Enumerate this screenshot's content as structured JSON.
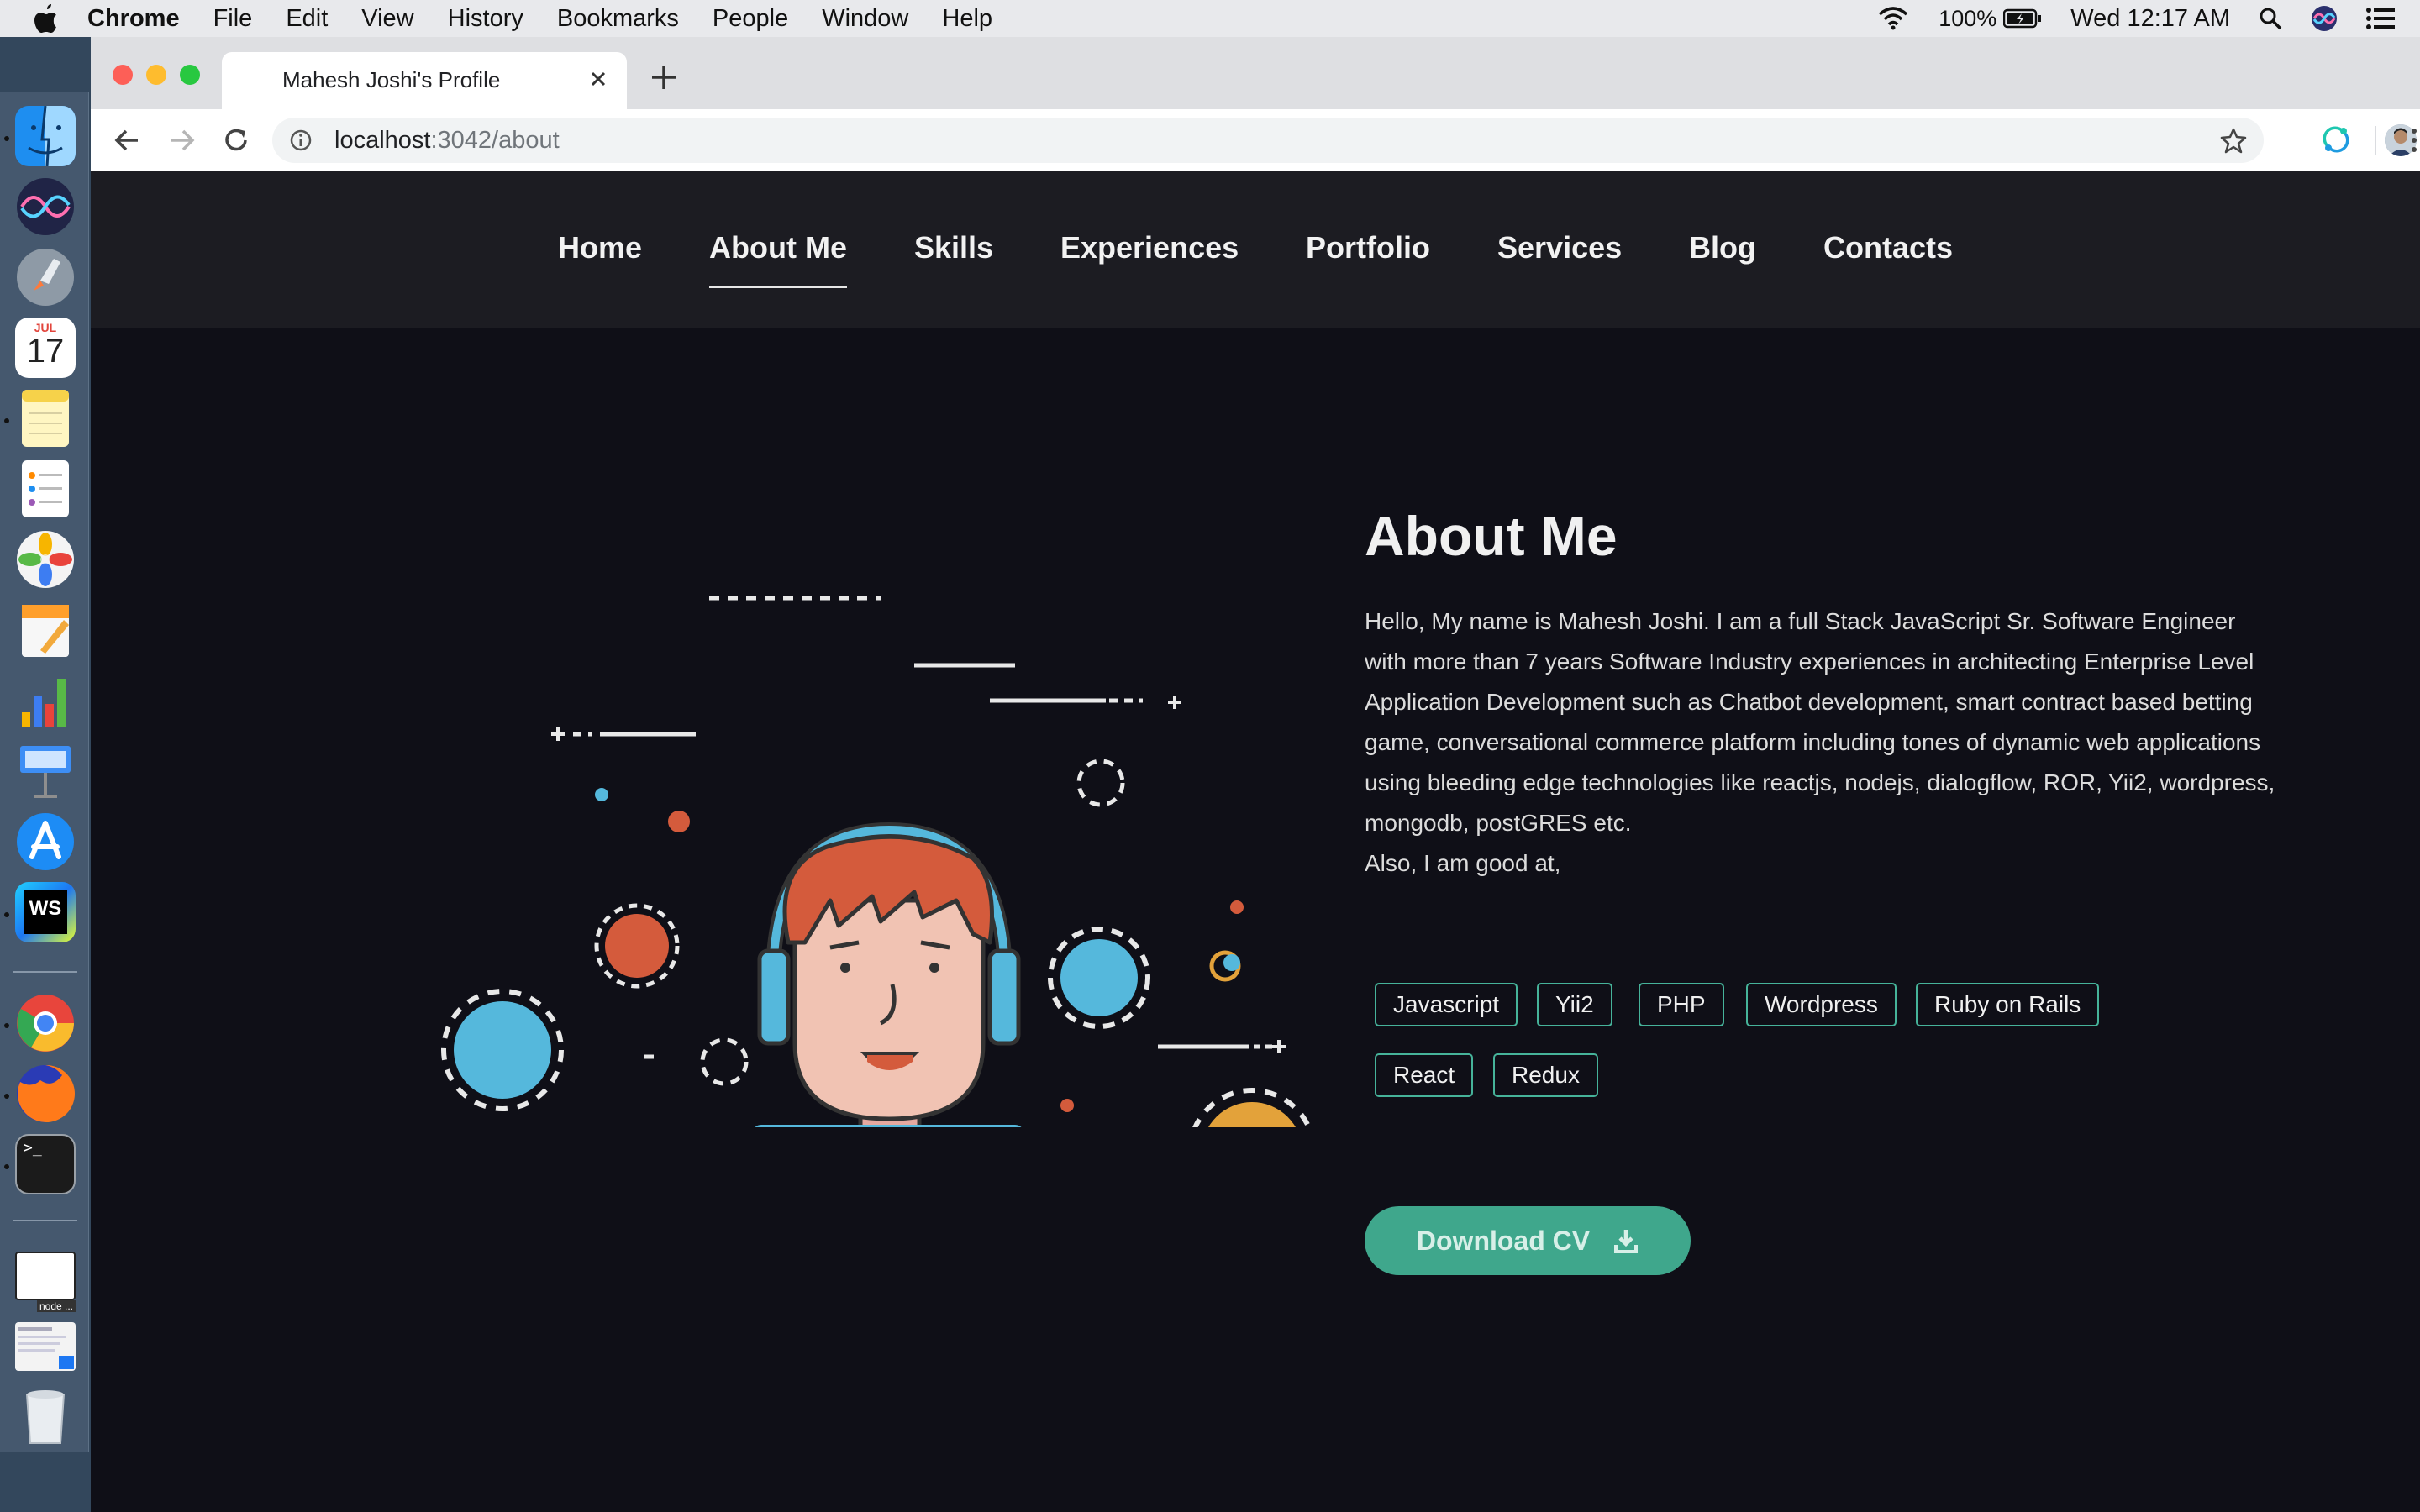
{
  "menubar": {
    "app": "Chrome",
    "items": [
      "File",
      "Edit",
      "View",
      "History",
      "Bookmarks",
      "People",
      "Window",
      "Help"
    ],
    "battery": "100%",
    "clock": "Wed 12:17 AM"
  },
  "dock": {
    "calendar_month": "JUL",
    "calendar_day": "17",
    "jetbrains_label": "WS",
    "terminal_prompt": ">_",
    "thumb_label": "node ..."
  },
  "browser": {
    "tab_title": "Mahesh Joshi's Profile",
    "url_host": "localhost",
    "url_path": ":3042/about"
  },
  "nav": {
    "items": [
      "Home",
      "About Me",
      "Skills",
      "Experiences",
      "Portfolio",
      "Services",
      "Blog",
      "Contacts"
    ],
    "active": "About Me"
  },
  "about": {
    "title": "About Me",
    "paragraph": "Hello, My name is Mahesh Joshi. I am a full Stack JavaScript Sr. Software Engineer with more than 7 years Software Industry experiences in architecting Enterprise Level Application Development such as Chatbot development, smart contract based betting game, conversational commerce platform including tones of dynamic web applications using bleeding edge technologies like reactjs, nodejs, dialogflow, ROR, Yii2, wordpress, mongodb, postGRES etc.",
    "also": "Also, I am good at,",
    "skills": [
      "Javascript",
      "Yii2",
      "PHP",
      "Wordpress",
      "Ruby on Rails",
      "React",
      "Redux"
    ],
    "download_label": "Download CV"
  },
  "colors": {
    "accent": "#3fa78c",
    "tag_border": "#46b39a",
    "page_bg": "#0f0f17",
    "nav_bg": "#1c1c22"
  }
}
